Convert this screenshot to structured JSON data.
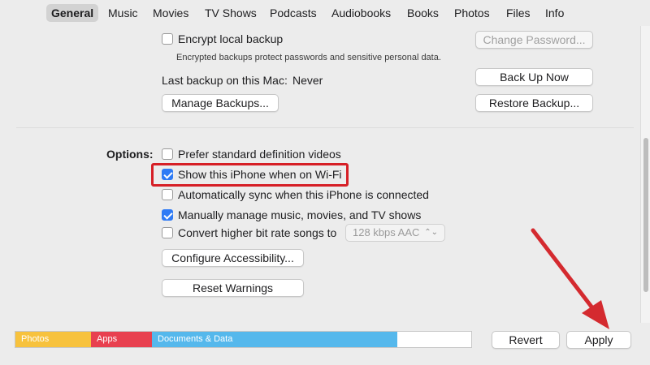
{
  "tabs": [
    {
      "label": "General",
      "active": true
    },
    {
      "label": "Music"
    },
    {
      "label": "Movies"
    },
    {
      "label": "TV Shows"
    },
    {
      "label": "Podcasts"
    },
    {
      "label": "Audiobooks"
    },
    {
      "label": "Books"
    },
    {
      "label": "Photos"
    },
    {
      "label": "Files"
    },
    {
      "label": "Info"
    }
  ],
  "backups": {
    "encrypt_label": "Encrypt local backup",
    "encrypt_checked": false,
    "encrypt_desc": "Encrypted backups protect passwords and sensitive personal data.",
    "change_password": "Change Password...",
    "last_backup_label": "Last backup on this Mac:",
    "last_backup_value": "Never",
    "back_up_now": "Back Up Now",
    "manage_backups": "Manage Backups...",
    "restore_backup": "Restore Backup..."
  },
  "options": {
    "heading": "Options:",
    "prefer_sd": "Prefer standard definition videos",
    "prefer_sd_checked": false,
    "show_wifi": "Show this iPhone when on Wi-Fi",
    "show_wifi_checked": true,
    "auto_sync": "Automatically sync when this iPhone is connected",
    "auto_sync_checked": false,
    "manual_manage": "Manually manage music, movies, and TV shows",
    "manual_manage_checked": true,
    "convert_bitrate": "Convert higher bit rate songs to",
    "convert_bitrate_checked": false,
    "bitrate_value": "128 kbps AAC",
    "configure_accessibility": "Configure Accessibility...",
    "reset_warnings": "Reset Warnings"
  },
  "storage": {
    "segments": [
      {
        "label": "Photos",
        "color": "#f7c23d"
      },
      {
        "label": "Apps",
        "color": "#e8404f"
      },
      {
        "label": "Documents & Data",
        "color": "#55b8ec"
      }
    ]
  },
  "footer": {
    "revert": "Revert",
    "apply": "Apply"
  },
  "colors": {
    "accent": "#2f7bf5",
    "highlight": "#d61f26",
    "arrow": "#d42a2f"
  }
}
